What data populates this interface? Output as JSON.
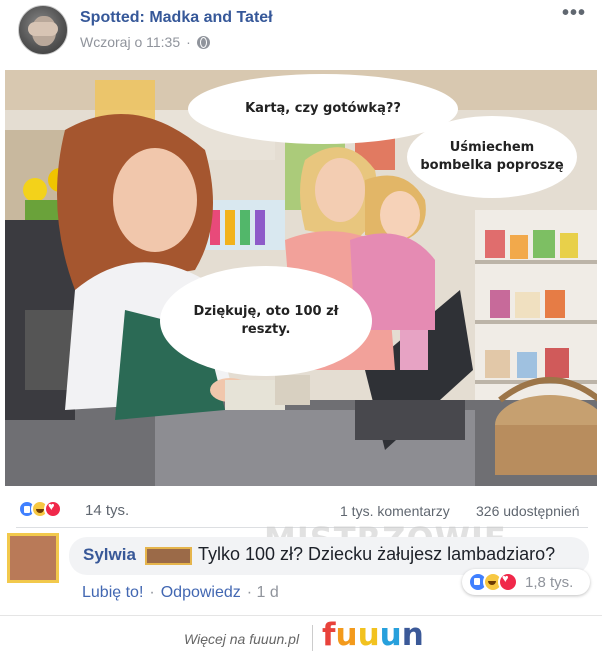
{
  "post": {
    "page_name": "Spotted: Madka and Tateł",
    "timestamp": "Wczoraj o 11:35",
    "privacy_icon": "globe-icon",
    "more_icon": "more-dots-icon",
    "more_label": "•••"
  },
  "photo": {
    "bubbles": [
      {
        "text": "Kartą, czy gotówką??"
      },
      {
        "text": "Uśmiechem bombelka poproszę"
      },
      {
        "text": "Dziękuję, oto 100 zł reszty."
      }
    ]
  },
  "stats": {
    "reaction_icons": [
      "like-icon",
      "haha-icon",
      "love-icon"
    ],
    "reactions": "14 tys.",
    "comments": "1 tys. komentarzy",
    "shares": "326 udostępnień"
  },
  "watermark": "MISTRZOWIE",
  "comment": {
    "author": "Sylwia",
    "text": "Tylko 100 zł? Dziecku żałujesz lambadziaro?",
    "reactions": "1,8 tys.",
    "like_action": "Lubię to!",
    "reply_action": "Odpowiedz",
    "separator": "·",
    "age": "· 1 d"
  },
  "footer": {
    "text": "Więcej na fuuun.pl",
    "logo": [
      "f",
      "u",
      "u",
      "u",
      "n"
    ]
  },
  "colors": {
    "link_blue": "#385898",
    "meta_gray": "#90949c",
    "like_blue": "#4080ff",
    "love_red": "#f0284a",
    "haha_yellow": "#f7c843"
  }
}
